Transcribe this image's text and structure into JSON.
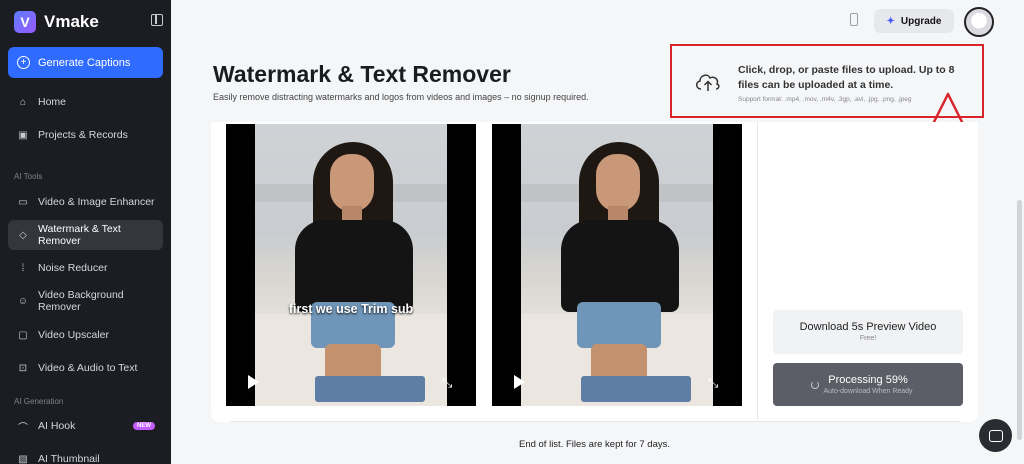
{
  "app": {
    "name": "Vmake",
    "logo_letter": "V"
  },
  "sidebar": {
    "generate_button": "Generate Captions",
    "items_main": [
      {
        "label": "Home",
        "icon": "home-icon",
        "glyph": "⌂"
      },
      {
        "label": "Projects & Records",
        "icon": "folder-icon",
        "glyph": "▣"
      }
    ],
    "section_tools": "AI Tools",
    "items_tools": [
      {
        "label": "Video & Image Enhancer",
        "icon": "hd-icon",
        "glyph": "▭"
      },
      {
        "label": "Watermark & Text Remover",
        "icon": "eraser-icon",
        "glyph": "◇",
        "active": true
      },
      {
        "label": "Noise Reducer",
        "icon": "waveform-icon",
        "glyph": "⁞"
      },
      {
        "label": "Video Background Remover",
        "icon": "person-icon",
        "glyph": "☺"
      },
      {
        "label": "Video Upscaler",
        "icon": "4k-icon",
        "glyph": "▢"
      },
      {
        "label": "Video & Audio to Text",
        "icon": "transcribe-icon",
        "glyph": "⊡"
      }
    ],
    "section_generation": "AI Generation",
    "items_generation": [
      {
        "label": "AI Hook",
        "icon": "hook-icon",
        "glyph": "⌒",
        "badge": "NEW"
      },
      {
        "label": "AI Thumbnail",
        "icon": "thumbnail-icon",
        "glyph": "▧"
      }
    ]
  },
  "topbar": {
    "upgrade_label": "Upgrade"
  },
  "header": {
    "title": "Watermark & Text Remover",
    "subtitle": "Easily remove distracting watermarks and logos from videos and images – no signup required."
  },
  "upload": {
    "text": "Click, drop, or paste files to upload. Up to 8 files can be uploaded at a time.",
    "support": "Support format: .mp4, .mov, .m4v, .3gp, .avi, .jpg, .png, .jpeg"
  },
  "videos": {
    "original_caption": "first we use Trim sub"
  },
  "actions": {
    "preview_label": "Download 5s Preview Video",
    "preview_sub": "Free!",
    "processing_label": "Processing 59%",
    "processing_sub": "Auto-download When Ready",
    "progress_percent": 59
  },
  "footer": {
    "text": "End of list. Files are kept for 7 days."
  },
  "colors": {
    "accent": "#2f6bff",
    "sidebar_bg": "#1b1d22",
    "highlight": "#d9242b"
  }
}
